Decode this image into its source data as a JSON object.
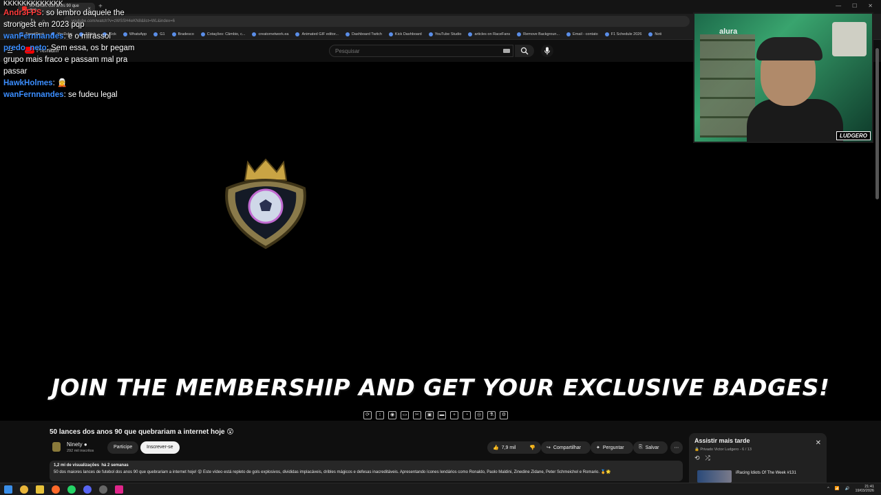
{
  "browser": {
    "tab_title": "50 lances dos anos 90 que que",
    "url": "youtube.com/watch?v=zWSSH4eKN8&list=WL&index=6",
    "bookmarks": [
      "TweetDeck",
      "YouTube",
      "Twitch",
      "Kick",
      "WhatsApp",
      "G1",
      "Bradesco",
      "Cotações: Câmbio, c...",
      "creatornetwork.ea",
      "Animated GIF editor...",
      "Dashboard Twitch",
      "Kick Dashboard",
      "YouTube Studio",
      "articles on RaceFans",
      "Remove Backgroun...",
      "Email - contato",
      "F1 Schedule 2026",
      "Noti"
    ]
  },
  "youtube": {
    "logo_label": "Premium",
    "search_placeholder": "Pesquisar"
  },
  "video": {
    "banner": "JOIN THE MEMBERSHIP AND GET YOUR EXCLUSIVE BADGES!",
    "title": "50 lances dos anos 90 que quebrariam a internet hoje 😲",
    "channel": "Ninety",
    "subscribers": "292 mil inscritos",
    "join_label": "Participe",
    "subscribe_label": "Inscrever-se",
    "likes": "7,9 mil",
    "share_label": "Compartilhar",
    "ask_label": "Perguntar",
    "save_label": "Salvar",
    "views": "1,2 mi de visualizações",
    "age": "há 2 semanas",
    "description": "50 dos maiores lances de futebol dos anos 90 que quebrariam a internet hoje! 😲 Este vídeo está repleto de gols explosivos, divididas implacáveis, dribles mágicos e defesas inacreditáveis. Apresentando ícones lendários como Ronaldo, Paolo Maldini, Zinedine Zidane, Peter Schmeichel e Romario. 🏅🌟"
  },
  "playlist": {
    "title": "Assistir mais tarde",
    "privacy": "Privado",
    "owner": "Victor Ludgero",
    "position": "6 / 13",
    "item_title": "iRacing Idiots Of The Week #131"
  },
  "chat": {
    "messages": [
      {
        "user": "",
        "text": "KKKKKKKKKKKKK",
        "color": "#ffffff"
      },
      {
        "user": "Andr3FPS",
        "text": ": so lembro daquele the strongest em 2023 pqp",
        "color": "#ff3b3b"
      },
      {
        "user": "wanFernnandes",
        "text": ": e o mirassol",
        "color": "#3b8eff"
      },
      {
        "user": "predo_neto",
        "text": ": Sem essa, os br pegam grupo mais fraco e passam mal pra passar",
        "color": "#3b8eff"
      },
      {
        "user": "HawkHolmes",
        "text": ":",
        "color": "#3b8eff"
      },
      {
        "user": "wanFernnandes",
        "text": ": se fudeu legal",
        "color": "#3b8eff"
      }
    ]
  },
  "webcam": {
    "shelf_label": "alura",
    "tag": "LUDGERO"
  },
  "taskbar": {
    "time": "21:41",
    "date": "19/03/2026"
  },
  "colors": {
    "youtube_red": "#ff0000",
    "background": "#0f0f0f",
    "chip": "#272727"
  }
}
